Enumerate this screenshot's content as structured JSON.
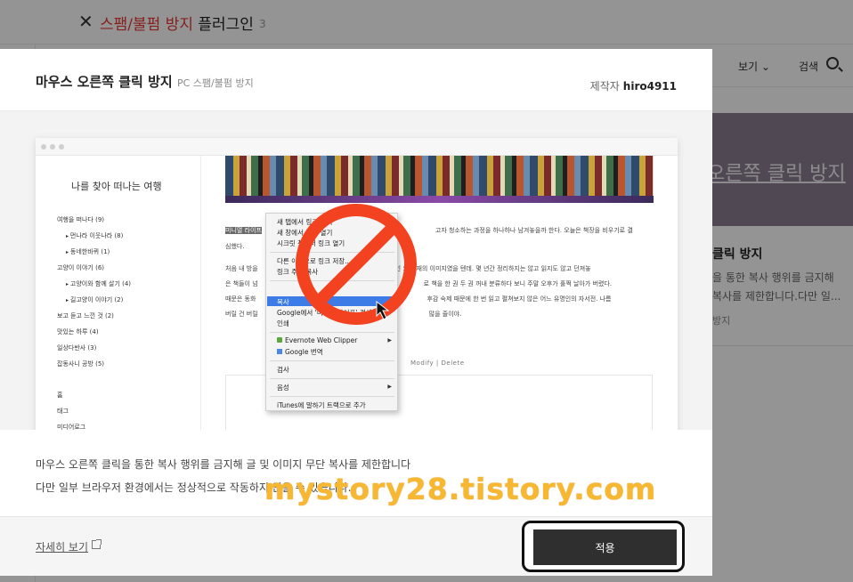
{
  "background": {
    "title_red": "스팸/불펌 방지",
    "title_rest": " 플러그인",
    "title_count": "3",
    "view_label": "보기",
    "search_label": "검색",
    "card_banner_text": "오른쪽 클릭 방지",
    "card_title": "클릭 방지",
    "card_desc_line1": "을 통한 복사 행위를 금지해",
    "card_desc_line2": "복사를 제한합니다.다만 일...",
    "card_tag": "방지"
  },
  "modal": {
    "title": "마우스 오른쪽 클릭 방지",
    "category": "PC 스팸/불펌 방지",
    "maker_label": "제작자",
    "maker_name": "hiro4911",
    "description_line1": "마우스 오른쪽 클릭을 통한 복사 행위를 금지해 글 및 이미지 무단 복사를 제한합니다",
    "description_line2": "다만 일부 브라우저 환경에서는 정상적으로 작동하지 않을 수 있습니다.",
    "detail_link": "자세히 보기",
    "apply_button": "적용"
  },
  "preview": {
    "blog_name": "나를 찾아 떠나는 여행",
    "categories": [
      {
        "label": "여행을 떠나다 (9)",
        "sub": false
      },
      {
        "label": "먼나라 이웃나라 (8)",
        "sub": true
      },
      {
        "label": "동네한바퀴 (1)",
        "sub": true
      },
      {
        "label": "고양이 이야기 (6)",
        "sub": false
      },
      {
        "label": "고양이와 함께 살기 (4)",
        "sub": true
      },
      {
        "label": "길고양이 이야기 (2)",
        "sub": true
      },
      {
        "label": "보고 듣고 느낀 것 (2)",
        "sub": false
      },
      {
        "label": "맛있는 하루 (4)",
        "sub": false
      },
      {
        "label": "일상다반사 (3)",
        "sub": false
      },
      {
        "label": "잡동사니 공방 (5)",
        "sub": false
      }
    ],
    "nav_home": "홈",
    "nav_tag": "태그",
    "nav_media": "미디어로그",
    "post_highlight": "미니멀 라이프",
    "post_line1": "고자 청소하는 과정을 하나하나 남겨놓을까 한다. 오늘은 책장을 비우기로 결",
    "post_line2": "심했다.",
    "post_line3": "처음 내 방을",
    "post_line3b": "인 오",
    "post_line3c": "서재의 이미지였을 텐데. 몇 년간 정리하지는 않고 읽지도 않고 던져놓",
    "post_line4": "은 책들이 넘",
    "post_line4b": "로 책을 한 권 두 권 꺼내 분류하다 보니 주말 오후가 훌쩍 날아가 버렸다.",
    "post_line5": "때문은 동화",
    "post_line5b": "후감 숙제 때문에 한 번 읽고 펼쳐보지 않은 어느 유명인의 자서전. 나름",
    "post_line6": "버릴 건 버릴",
    "post_line6b": "많을 줄이야.",
    "modify_delete": "Modify  |  Delete",
    "context_menu": {
      "item1": "새 탭에서 링크 열기",
      "item2": "새 창에서 링크 열기",
      "item3": "시크릿 창에서 링크 열기",
      "item4": "다른 이름으로 링크 저장...",
      "item5": "링크 주소 복사",
      "item6_highlighted": "복사",
      "item7": "Google에서 '미니멀 라이프' 검색",
      "item8": "인쇄",
      "item9": "Evernote Web Clipper",
      "item10": "Google 번역",
      "item11": "검사",
      "item12": "음성",
      "item13": "iTunes에 말하기 트랙으로 추가"
    }
  },
  "watermark": "mystory28.tistory.com",
  "colors": {
    "accent_red": "#e53935",
    "no_sign_red": "#f2421f",
    "apply_bg": "#2f2f2f",
    "watermark": "#f7b731"
  }
}
